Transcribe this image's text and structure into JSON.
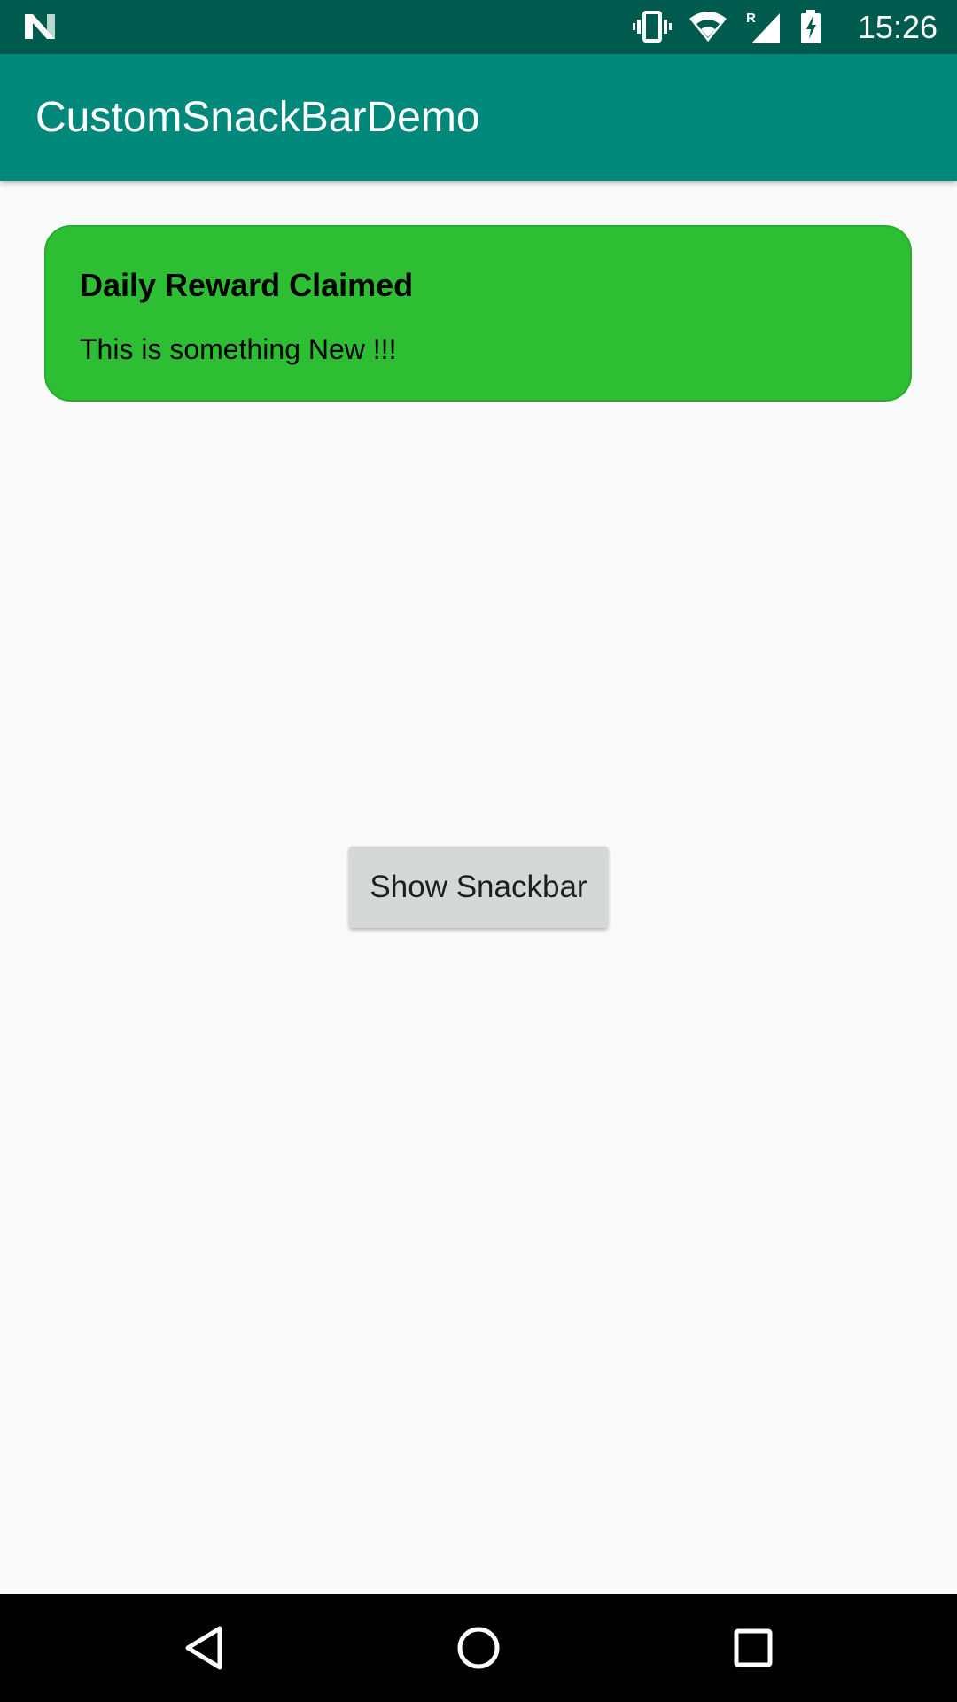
{
  "status_bar": {
    "time": "15:26",
    "icons": [
      "n-logo-icon",
      "vibrate-icon",
      "wifi-icon",
      "cell-signal-icon",
      "battery-charging-icon"
    ],
    "roaming_indicator": "R"
  },
  "app_bar": {
    "title": "CustomSnackBarDemo"
  },
  "snackbar": {
    "title": "Daily Reward Claimed",
    "message": "This is something New !!!",
    "background_color": "#2dbe34"
  },
  "main": {
    "show_button_label": "Show Snackbar"
  },
  "nav_bar": {
    "buttons": [
      "back-icon",
      "home-icon",
      "recents-icon"
    ]
  },
  "colors": {
    "status_bar": "#005b4f",
    "app_bar": "#00897b",
    "page_background": "#fafafa",
    "button_background": "#d6d7d7"
  }
}
